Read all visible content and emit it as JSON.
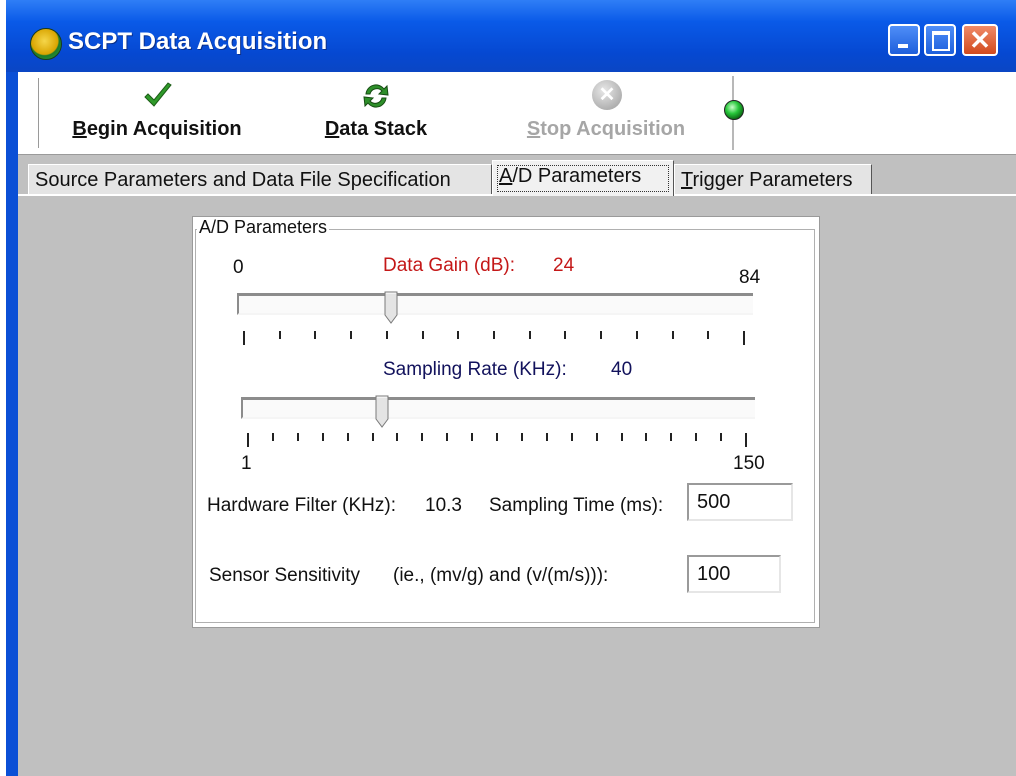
{
  "window": {
    "title": "SCPT Data Acquisition",
    "icon_text": "SCPT"
  },
  "toolbar": {
    "begin": {
      "underline": "B",
      "rest": "egin Acquisition"
    },
    "stack": {
      "underline": "D",
      "rest": "ata Stack"
    },
    "stop": {
      "underline": "S",
      "rest": "top Acquisition"
    }
  },
  "tabs": [
    {
      "label": "Source Parameters and Data File Specification"
    },
    {
      "underline": "A",
      "rest": "/D Parameters"
    },
    {
      "underline": "T",
      "rest": "rigger Parameters"
    }
  ],
  "ad": {
    "group_title": "A/D Parameters",
    "gain": {
      "label": "Data Gain (dB):",
      "value": "24",
      "min": "0",
      "max": "84",
      "level": 24
    },
    "rate": {
      "label": "Sampling Rate (KHz):",
      "value": "40",
      "min": "1",
      "max": "150",
      "level": 40
    },
    "filter": {
      "label": "Hardware Filter (KHz):",
      "value": "10.3"
    },
    "sampling_time": {
      "label": "Sampling Time (ms):",
      "value": "500"
    },
    "sensitivity": {
      "label": "Sensor Sensitivity",
      "hint": "(ie., (mv/g) and (v/(m/s))):",
      "value": "100"
    }
  },
  "colors": {
    "gain_text": "#c41818",
    "rate_text": "#12125c",
    "title_bar": "#0a5ae8"
  }
}
